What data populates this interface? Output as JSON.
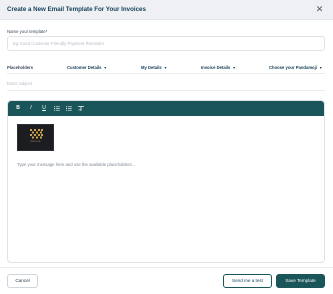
{
  "dialog": {
    "title": "Create a New Email Template For Your Invoices",
    "close_icon": "close-icon"
  },
  "form": {
    "name_label": "Name your template*",
    "name_placeholder": "Eg Good Customer Friendly Payment Reminder",
    "placeholders_label": "Placeholders",
    "dropdowns": [
      {
        "label": "Customer Details"
      },
      {
        "label": "My Details"
      },
      {
        "label": "Invoice Details"
      },
      {
        "label": "Choose your Pandamoji"
      }
    ],
    "subject_placeholder": "Enter subject"
  },
  "editor": {
    "toolbar": [
      {
        "label": "B",
        "icon": "bold-icon"
      },
      {
        "label": "I",
        "icon": "italic-icon"
      },
      {
        "label": "U",
        "icon": "underline-icon"
      },
      {
        "icon": "bulleted-list-icon"
      },
      {
        "icon": "numbered-list-icon"
      },
      {
        "icon": "clear-format-icon"
      }
    ],
    "logo_text": "INVOICE",
    "body_placeholder": "Type your message here and use the available placeholders..."
  },
  "footer": {
    "cancel_label": "Cancel",
    "test_label": "Send me a test",
    "save_label": "Save Template"
  },
  "colors": {
    "accent": "#1a5559",
    "title": "#16425b",
    "header_bg": "#eef0f3"
  }
}
